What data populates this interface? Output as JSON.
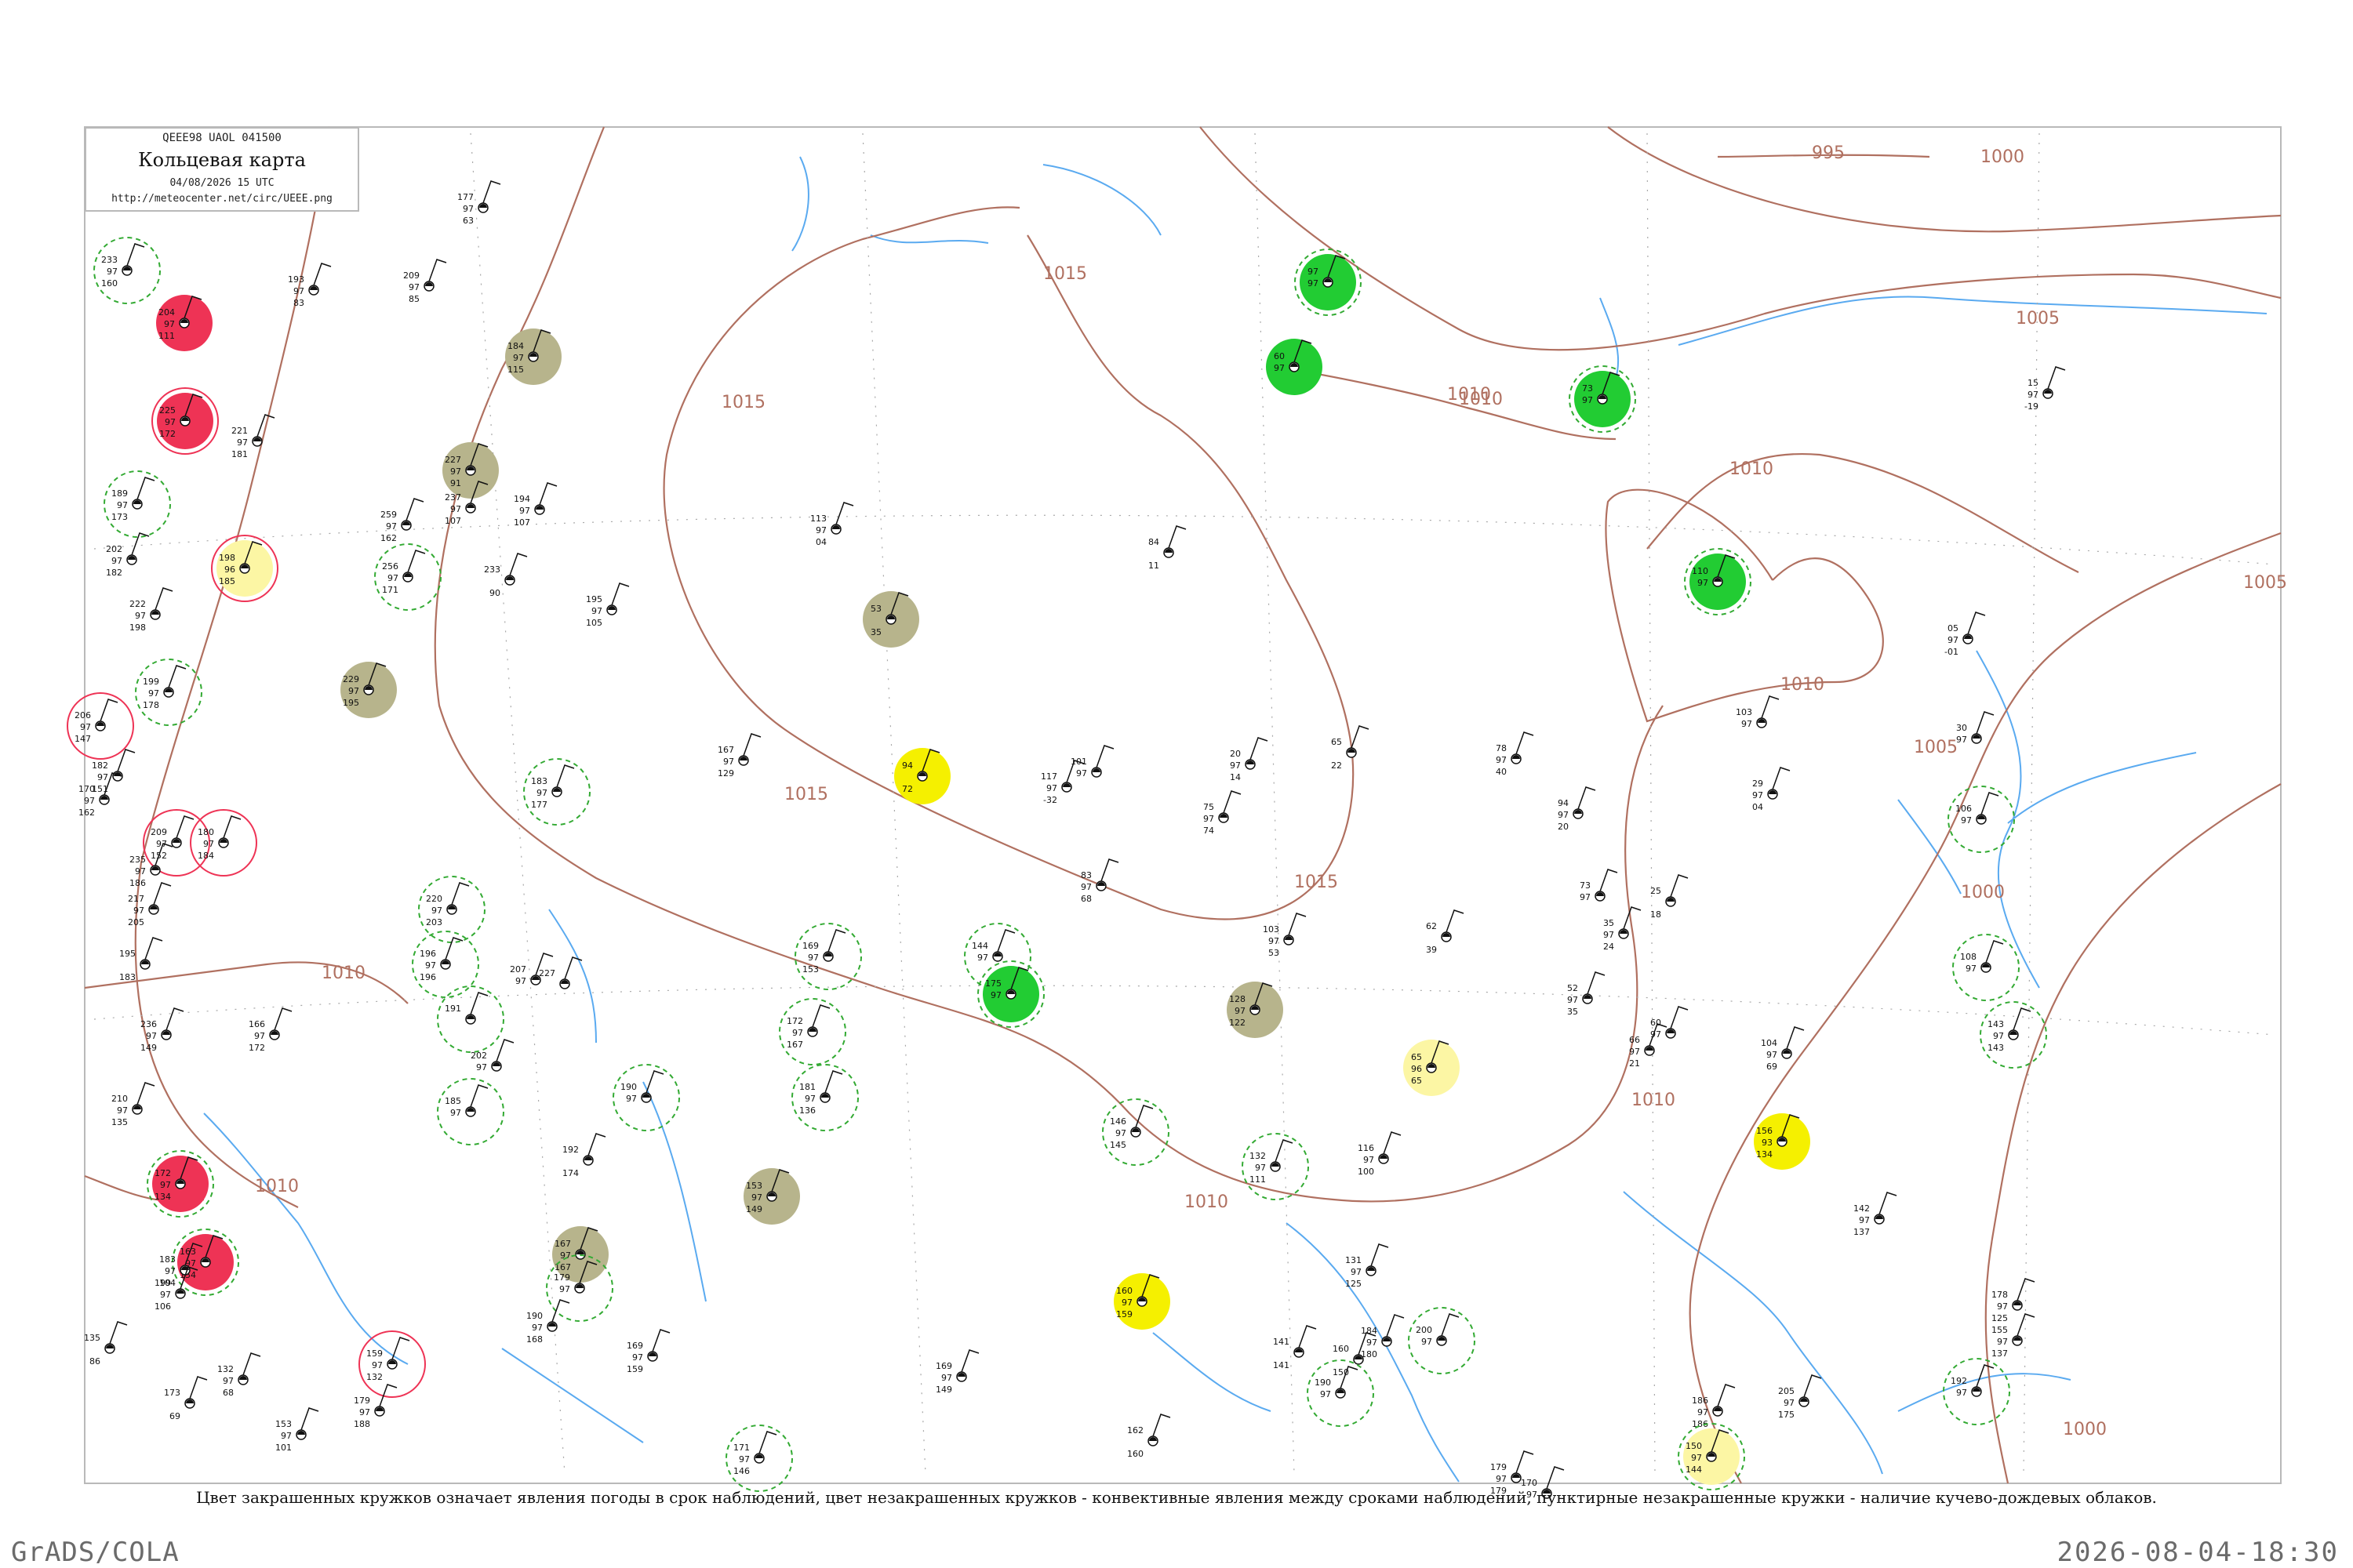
{
  "header": {
    "code_line": "QEEE98  UAOL  041500",
    "title": "Кольцевая карта",
    "date": "04/08/2026 15 UTC",
    "url": "http://meteocenter.net/circ/UEEE.png"
  },
  "caption": "Цвет закрашенных кружков означает явления погоды в срок наблюдений, цвет незакрашенных кружков - конвективные явления между сроками наблюдений, пунктирные незакрашенные кружки - наличие кучево-дождевых облаков.",
  "footer": {
    "left": "GrADS/COLA",
    "right": "2026-08-04-18:30"
  },
  "colors": {
    "isobar": "#b07060",
    "river": "#5aaaf0",
    "green": "#22cc33",
    "red": "#ee3355",
    "olive": "#b7b48c",
    "yellow": "#f5f000",
    "light_yellow": "#fcf6a4",
    "dashed_ring": "#33aa33",
    "station_text": "#111111"
  },
  "isobar_labels": [
    "995",
    "1000",
    "1005",
    "1010",
    "1010",
    "1010",
    "1010",
    "1010",
    "1010",
    "1015",
    "1015",
    "1015",
    "1015",
    "1005",
    "1005",
    "1000",
    "1000",
    "1010",
    "1010"
  ],
  "stations": [
    {
      "t": "233",
      "p": "97",
      "d": "160",
      "c": "",
      "r": "g"
    },
    {
      "t": "204",
      "p": "97",
      "d": "111",
      "c": "red",
      "r": ""
    },
    {
      "t": "225",
      "p": "97",
      "d": "172",
      "c": "red",
      "r": "r"
    },
    {
      "t": "221",
      "p": "97",
      "d": "181",
      "c": "",
      "r": ""
    },
    {
      "t": "189",
      "p": "97",
      "d": "173",
      "c": "",
      "r": "g"
    },
    {
      "t": "202",
      "p": "97",
      "d": "182",
      "c": "",
      "r": ""
    },
    {
      "t": "198",
      "p": "96",
      "d": "185",
      "c": "lyellow",
      "r": "r"
    },
    {
      "t": "222",
      "p": "97",
      "d": "198",
      "c": "",
      "r": ""
    },
    {
      "t": "199",
      "p": "97",
      "d": "178",
      "c": "",
      "r": "g"
    },
    {
      "t": "206",
      "p": "97",
      "d": "147",
      "c": "",
      "r": "r"
    },
    {
      "t": "182",
      "p": "97",
      "d": "151",
      "c": "",
      "r": ""
    },
    {
      "t": "170",
      "p": "97",
      "d": "162",
      "c": "",
      "r": ""
    },
    {
      "t": "209",
      "p": "97",
      "d": "152",
      "c": "",
      "r": "r"
    },
    {
      "t": "180",
      "p": "97",
      "d": "184",
      "c": "",
      "r": "r"
    },
    {
      "t": "235",
      "p": "97",
      "d": "186",
      "c": "",
      "r": ""
    },
    {
      "t": "217",
      "p": "97",
      "d": "205",
      "c": "",
      "r": ""
    },
    {
      "t": "195",
      "p": "",
      "d": "183",
      "c": "",
      "r": ""
    },
    {
      "t": "236",
      "p": "97",
      "d": "149",
      "c": "",
      "r": ""
    },
    {
      "t": "166",
      "p": "97",
      "d": "172",
      "c": "",
      "r": ""
    },
    {
      "t": "210",
      "p": "97",
      "d": "135",
      "c": "",
      "r": ""
    },
    {
      "t": "172",
      "p": "97",
      "d": "134",
      "c": "red",
      "r": "g"
    },
    {
      "t": "163",
      "p": "97",
      "d": "154",
      "c": "red",
      "r": "g"
    },
    {
      "t": "183",
      "p": "97",
      "d": "104",
      "c": "",
      "r": ""
    },
    {
      "t": "199",
      "p": "97",
      "d": "106",
      "c": "",
      "r": ""
    },
    {
      "t": "159",
      "p": "97",
      "d": "132",
      "c": "",
      "r": "r"
    },
    {
      "t": "135",
      "p": "",
      "d": "86",
      "c": "",
      "r": ""
    },
    {
      "t": "132",
      "p": "97",
      "d": "68",
      "c": "",
      "r": ""
    },
    {
      "t": "153",
      "p": "97",
      "d": "101",
      "c": "",
      "r": ""
    },
    {
      "t": "173",
      "p": "",
      "d": "69",
      "c": "",
      "r": ""
    },
    {
      "t": "179",
      "p": "97",
      "d": "188",
      "c": "",
      "r": ""
    },
    {
      "t": "209",
      "p": "97",
      "d": "85",
      "c": "",
      "r": ""
    },
    {
      "t": "184",
      "p": "97",
      "d": "115",
      "c": "olive",
      "r": ""
    },
    {
      "t": "227",
      "p": "97",
      "d": "91",
      "c": "olive",
      "r": ""
    },
    {
      "t": "237",
      "p": "97",
      "d": "107",
      "c": "",
      "r": ""
    },
    {
      "t": "256",
      "p": "97",
      "d": "171",
      "c": "",
      "r": "g"
    },
    {
      "t": "259",
      "p": "97",
      "d": "162",
      "c": "",
      "r": ""
    },
    {
      "t": "229",
      "p": "97",
      "d": "195",
      "c": "olive",
      "r": ""
    },
    {
      "t": "193",
      "p": "97",
      "d": "83",
      "c": "",
      "r": ""
    },
    {
      "t": "177",
      "p": "97",
      "d": "63",
      "c": "",
      "r": ""
    },
    {
      "t": "233",
      "p": "",
      "d": "90",
      "c": "",
      "r": ""
    },
    {
      "t": "194",
      "p": "97",
      "d": "107",
      "c": "",
      "r": ""
    },
    {
      "t": "195",
      "p": "97",
      "d": "105",
      "c": "",
      "r": ""
    },
    {
      "t": "183",
      "p": "97",
      "d": "177",
      "c": "",
      "r": "g"
    },
    {
      "t": "220",
      "p": "97",
      "d": "203",
      "c": "",
      "r": "g"
    },
    {
      "t": "196",
      "p": "97",
      "d": "196",
      "c": "",
      "r": "g"
    },
    {
      "t": "191",
      "p": "",
      "d": "",
      "c": "",
      "r": "g"
    },
    {
      "t": "207",
      "p": "97",
      "d": "",
      "c": "",
      "r": ""
    },
    {
      "t": "227",
      "p": "",
      "d": "",
      "c": "",
      "r": ""
    },
    {
      "t": "185",
      "p": "97",
      "d": "",
      "c": "",
      "r": "g"
    },
    {
      "t": "202",
      "p": "97",
      "d": "",
      "c": "",
      "r": ""
    },
    {
      "t": "190",
      "p": "97",
      "d": "",
      "c": "",
      "r": "g"
    },
    {
      "t": "192",
      "p": "",
      "d": "174",
      "c": "",
      "r": ""
    },
    {
      "t": "167",
      "p": "97",
      "d": "167",
      "c": "olive",
      "r": ""
    },
    {
      "t": "179",
      "p": "97",
      "d": "",
      "c": "",
      "r": "g"
    },
    {
      "t": "190",
      "p": "97",
      "d": "168",
      "c": "",
      "r": ""
    },
    {
      "t": "169",
      "p": "97",
      "d": "159",
      "c": "",
      "r": ""
    },
    {
      "t": "153",
      "p": "97",
      "d": "149",
      "c": "olive",
      "r": ""
    },
    {
      "t": "167",
      "p": "97",
      "d": "129",
      "c": "",
      "r": ""
    },
    {
      "t": "169",
      "p": "97",
      "d": "153",
      "c": "",
      "r": "g"
    },
    {
      "t": "172",
      "p": "97",
      "d": "167",
      "c": "",
      "r": "g"
    },
    {
      "t": "181",
      "p": "97",
      "d": "136",
      "c": "",
      "r": "g"
    },
    {
      "t": "171",
      "p": "97",
      "d": "146",
      "c": "",
      "r": "g"
    },
    {
      "t": "113",
      "p": "97",
      "d": "04",
      "c": "",
      "r": ""
    },
    {
      "t": "53",
      "p": "",
      "d": "35",
      "c": "olive",
      "r": ""
    },
    {
      "t": "94",
      "p": "",
      "d": "72",
      "c": "yellow",
      "r": ""
    },
    {
      "t": "144",
      "p": "97",
      "d": "",
      "c": "",
      "r": "g"
    },
    {
      "t": "175",
      "p": "97",
      "d": "",
      "c": "green",
      "r": "g"
    },
    {
      "t": "117",
      "p": "97",
      "d": "-32",
      "c": "",
      "r": ""
    },
    {
      "t": "101",
      "p": "97",
      "d": "",
      "c": "",
      "r": ""
    },
    {
      "t": "83",
      "p": "97",
      "d": "68",
      "c": "",
      "r": ""
    },
    {
      "t": "146",
      "p": "97",
      "d": "145",
      "c": "",
      "r": "g"
    },
    {
      "t": "160",
      "p": "97",
      "d": "159",
      "c": "yellow",
      "r": ""
    },
    {
      "t": "84",
      "p": "",
      "d": "11",
      "c": "",
      "r": ""
    },
    {
      "t": "128",
      "p": "97",
      "d": "122",
      "c": "olive",
      "r": ""
    },
    {
      "t": "132",
      "p": "97",
      "d": "111",
      "c": "",
      "r": "g"
    },
    {
      "t": "103",
      "p": "97",
      "d": "53",
      "c": "",
      "r": ""
    },
    {
      "t": "75",
      "p": "97",
      "d": "74",
      "c": "",
      "r": ""
    },
    {
      "t": "20",
      "p": "97",
      "d": "14",
      "c": "",
      "r": ""
    },
    {
      "t": "65",
      "p": "",
      "d": "22",
      "c": "",
      "r": ""
    },
    {
      "t": "62",
      "p": "",
      "d": "39",
      "c": "",
      "r": ""
    },
    {
      "t": "65",
      "p": "96",
      "d": "65",
      "c": "lyellow",
      "r": ""
    },
    {
      "t": "116",
      "p": "97",
      "d": "100",
      "c": "",
      "r": ""
    },
    {
      "t": "131",
      "p": "97",
      "d": "125",
      "c": "",
      "r": ""
    },
    {
      "t": "184",
      "p": "97",
      "d": "180",
      "c": "",
      "r": ""
    },
    {
      "t": "200",
      "p": "97",
      "d": "",
      "c": "",
      "r": "g"
    },
    {
      "t": "160",
      "p": "",
      "d": "150",
      "c": "",
      "r": ""
    },
    {
      "t": "141",
      "p": "",
      "d": "141",
      "c": "",
      "r": ""
    },
    {
      "t": "162",
      "p": "",
      "d": "160",
      "c": "",
      "r": ""
    },
    {
      "t": "190",
      "p": "97",
      "d": "",
      "c": "",
      "r": "g"
    },
    {
      "t": "97",
      "p": "97",
      "d": "",
      "c": "green",
      "r": "g"
    },
    {
      "t": "60",
      "p": "97",
      "d": "",
      "c": "green",
      "r": ""
    },
    {
      "t": "73",
      "p": "97",
      "d": "",
      "c": "green",
      "r": "g"
    },
    {
      "t": "110",
      "p": "97",
      "d": "",
      "c": "green",
      "r": "g"
    },
    {
      "t": "78",
      "p": "97",
      "d": "40",
      "c": "",
      "r": ""
    },
    {
      "t": "94",
      "p": "97",
      "d": "20",
      "c": "",
      "r": ""
    },
    {
      "t": "73",
      "p": "97",
      "d": "",
      "c": "",
      "r": ""
    },
    {
      "t": "35",
      "p": "97",
      "d": "24",
      "c": "",
      "r": ""
    },
    {
      "t": "52",
      "p": "97",
      "d": "35",
      "c": "",
      "r": ""
    },
    {
      "t": "25",
      "p": "",
      "d": "18",
      "c": "",
      "r": ""
    },
    {
      "t": "60",
      "p": "97",
      "d": "",
      "c": "",
      "r": ""
    },
    {
      "t": "66",
      "p": "97",
      "d": "21",
      "c": "",
      "r": ""
    },
    {
      "t": "104",
      "p": "97",
      "d": "69",
      "c": "",
      "r": ""
    },
    {
      "t": "103",
      "p": "97",
      "d": "",
      "c": "",
      "r": ""
    },
    {
      "t": "29",
      "p": "97",
      "d": "04",
      "c": "",
      "r": ""
    },
    {
      "t": "30",
      "p": "97",
      "d": "",
      "c": "",
      "r": ""
    },
    {
      "t": "106",
      "p": "97",
      "d": "",
      "c": "",
      "r": "g"
    },
    {
      "t": "108",
      "p": "97",
      "d": "",
      "c": "",
      "r": "g"
    },
    {
      "t": "143",
      "p": "97",
      "d": "143",
      "c": "",
      "r": "g"
    },
    {
      "t": "156",
      "p": "93",
      "d": "134",
      "c": "yellow",
      "r": ""
    },
    {
      "t": "142",
      "p": "97",
      "d": "137",
      "c": "",
      "r": ""
    },
    {
      "t": "178",
      "p": "97",
      "d": "125",
      "c": "",
      "r": ""
    },
    {
      "t": "15",
      "p": "97",
      "d": "-19",
      "c": "",
      "r": ""
    },
    {
      "t": "05",
      "p": "97",
      "d": "-01",
      "c": "",
      "r": ""
    },
    {
      "t": "155",
      "p": "97",
      "d": "137",
      "c": "",
      "r": ""
    },
    {
      "t": "186",
      "p": "97",
      "d": "186",
      "c": "",
      "r": ""
    },
    {
      "t": "150",
      "p": "97",
      "d": "144",
      "c": "lyellow",
      "r": "g"
    },
    {
      "t": "205",
      "p": "97",
      "d": "175",
      "c": "",
      "r": ""
    },
    {
      "t": "192",
      "p": "97",
      "d": "",
      "c": "",
      "r": "g"
    },
    {
      "t": "179",
      "p": "97",
      "d": "179",
      "c": "",
      "r": ""
    },
    {
      "t": "170",
      "p": "97",
      "d": "",
      "c": "",
      "r": ""
    },
    {
      "t": "169",
      "p": "97",
      "d": "149",
      "c": "",
      "r": ""
    }
  ]
}
